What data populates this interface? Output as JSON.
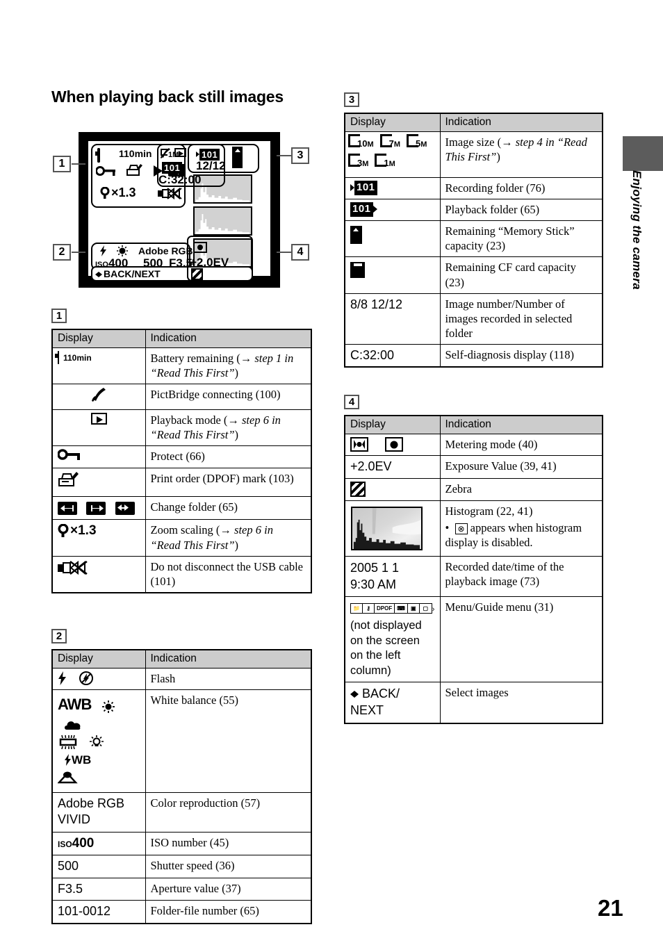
{
  "page": {
    "heading": "When playing back still images",
    "number": "21",
    "side_tab_label": "Enjoying the camera"
  },
  "lcd": {
    "callouts": [
      "1",
      "2",
      "3",
      "4"
    ],
    "group1": {
      "battery_time": "110min",
      "icons": [
        "battery-icon",
        "pictbridge-icon",
        "playback-mode-icon",
        "protect-key-icon",
        "dpof-print-icon",
        "play-triangle-icon",
        "change-folder-icon",
        "usb-do-not-disconnect-icon"
      ],
      "zoom_scaling": "×1.3"
    },
    "group2": {
      "flash": "flash-icon",
      "white_balance": "incandescent-icon",
      "color_reproduction": "Adobe RGB",
      "iso_prefix": "ISO",
      "iso_value": "400",
      "shutter_speed": "500",
      "aperture": "F3.5",
      "back_next": "BACK/NEXT"
    },
    "group3": {
      "image_size": "1M",
      "recording_folder": "101",
      "playback_folder": "101",
      "image_count": "12/12",
      "self_diagnosis": "C:32:00"
    },
    "group4": {
      "exposure_value": "+2.0EV",
      "metering_icon": "spot-metering-icon",
      "zebra_icon": "zebra-icon"
    }
  },
  "tables": [
    {
      "marker": "1",
      "headers": [
        "Display",
        "Indication"
      ],
      "rows": [
        {
          "display_text": "110min",
          "display_icon": "battery-icon",
          "indication_html": "Battery remaining (→ <i>step 1 in “Read This First”</i>)"
        },
        {
          "display_text": "",
          "display_icon": "pictbridge-icon",
          "indication_html": "PictBridge connecting (100)"
        },
        {
          "display_text": "",
          "display_icon": "playback-mode-icon",
          "indication_html": "Playback mode (→ <i>step 6 in “Read This First”</i>)"
        },
        {
          "display_text": "",
          "display_icon": "protect-key-icon",
          "indication_html": "Protect (66)"
        },
        {
          "display_text": "",
          "display_icon": "dpof-print-icon",
          "indication_html": "Print order (DPOF) mark (103)"
        },
        {
          "display_text": "",
          "display_icon": "change-folder-icons",
          "indication_html": "Change folder (65)"
        },
        {
          "display_text": "×1.3",
          "display_icon": "magnifier-icon",
          "indication_html": "Zoom scaling (→ <i>step 6 in “Read This First”</i>)"
        },
        {
          "display_text": "",
          "display_icon": "usb-do-not-disconnect-icon",
          "indication_html": "Do not disconnect the USB cable (101)"
        }
      ]
    },
    {
      "marker": "2",
      "headers": [
        "Display",
        "Indication"
      ],
      "rows": [
        {
          "display_text": "",
          "display_icon": "flash-icons",
          "indication_html": "Flash"
        },
        {
          "display_text": "AWB",
          "display_icon": "white-balance-icons",
          "indication_html": "White balance (55)"
        },
        {
          "display_text": "Adobe RGB VIVID",
          "display_icon": "",
          "indication_html": "Color reproduction (57)"
        },
        {
          "display_text": "ISO400",
          "display_icon": "iso-icon",
          "indication_html": "ISO number (45)"
        },
        {
          "display_text": "500",
          "display_icon": "",
          "indication_html": "Shutter speed (36)"
        },
        {
          "display_text": "F3.5",
          "display_icon": "",
          "indication_html": "Aperture value (37)"
        },
        {
          "display_text": "101-0012",
          "display_icon": "",
          "indication_html": "Folder-file number (65)"
        }
      ]
    },
    {
      "marker": "3",
      "headers": [
        "Display",
        "Indication"
      ],
      "rows": [
        {
          "display_text": "10M 7M 5M 3M 1M",
          "display_icon": "image-size-icons",
          "indication_html": "Image size (→ <i>step 4 in “Read This First”</i>)"
        },
        {
          "display_text": "101",
          "display_icon": "recording-folder-icon",
          "indication_html": "Recording folder (76)"
        },
        {
          "display_text": "101",
          "display_icon": "playback-folder-icon",
          "indication_html": "Playback folder (65)"
        },
        {
          "display_text": "",
          "display_icon": "memory-stick-capacity-icon",
          "indication_html": "Remaining “Memory Stick” capacity (23)"
        },
        {
          "display_text": "",
          "display_icon": "cf-card-capacity-icon",
          "indication_html": "Remaining CF card capacity (23)"
        },
        {
          "display_text": "8/8 12/12",
          "display_icon": "",
          "indication_html": "Image number/Number of images recorded in selected folder"
        },
        {
          "display_text": "C:32:00",
          "display_icon": "",
          "indication_html": "Self-diagnosis display (118)"
        }
      ]
    },
    {
      "marker": "4",
      "headers": [
        "Display",
        "Indication"
      ],
      "rows": [
        {
          "display_text": "",
          "display_icon": "metering-mode-icons",
          "indication_html": "Metering mode (40)"
        },
        {
          "display_text": "+2.0EV",
          "display_icon": "",
          "indication_html": "Exposure Value (39, 41)"
        },
        {
          "display_text": "",
          "display_icon": "zebra-icon",
          "indication_html": "Zebra"
        },
        {
          "display_text": "",
          "display_icon": "histogram-thumbnail",
          "indication_html": "Histogram (22, 41)",
          "bullet_html": "• &nbsp;appears when histogram display is disabled."
        },
        {
          "display_text": "2005 1 1 9:30 AM",
          "display_icon": "",
          "indication_html": "Recorded date/time of the playback image (73)"
        },
        {
          "display_text": "(not displayed on the screen on the left column)",
          "display_icon": "menu-guide-icons",
          "indication_html": "Menu/Guide menu (31)"
        },
        {
          "display_text": "BACK/ NEXT",
          "display_icon": "left-right-arrows-icon",
          "indication_html": "Select images"
        }
      ]
    }
  ]
}
